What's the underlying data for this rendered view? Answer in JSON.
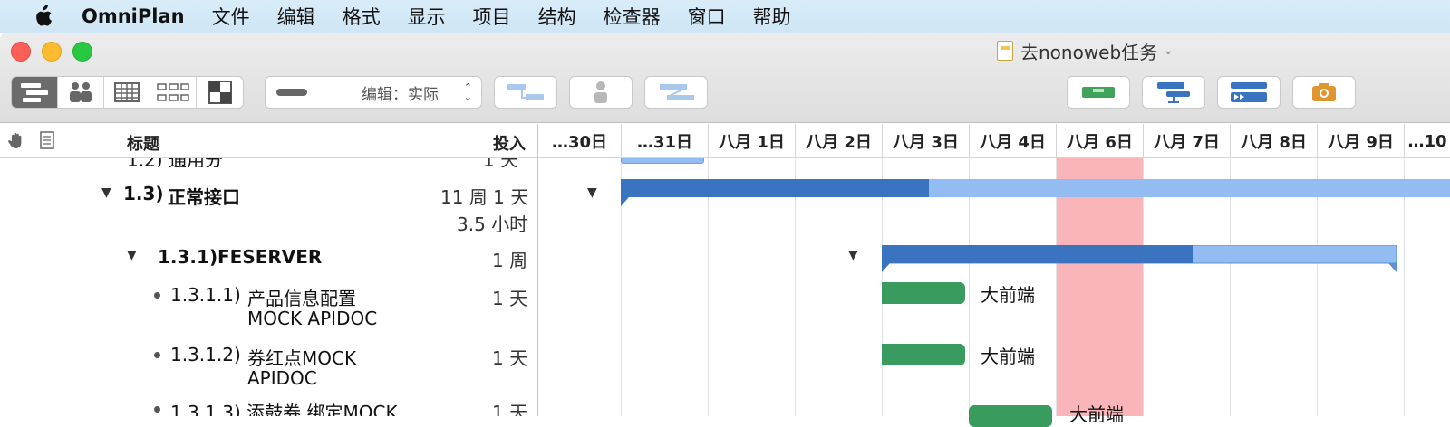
{
  "menubar": {
    "app_name": "OmniPlan",
    "items": [
      "文件",
      "编辑",
      "格式",
      "显示",
      "项目",
      "结构",
      "检查器",
      "窗口",
      "帮助"
    ]
  },
  "window": {
    "title": "去nonoweb任务",
    "popup_label": "编辑：实际"
  },
  "header": {
    "title_col": "标题",
    "effort_col": "投入",
    "dates": [
      "…30日",
      "…31日",
      "八月 1日",
      "八月 2日",
      "八月 3日",
      "八月 4日",
      "八月 6日",
      "八月 7日",
      "八月 8日",
      "八月 9日",
      "…10"
    ]
  },
  "outline": {
    "partial_top": "1.2)  通用分",
    "partial_top_effort": "1 天",
    "row_13_num": "1.3)",
    "row_13_title": "正常接口",
    "row_13_effort_1": "11 周 1 天",
    "row_13_effort_2": "3.5 小时",
    "row_131_num": "1.3.1)",
    "row_131_title": "FESERVER",
    "row_131_effort": "1 周",
    "row_1311_num": "1.3.1.1)",
    "row_1311_title_1": "产品信息配置",
    "row_1311_title_2": "MOCK APIDOC",
    "row_1311_effort": "1 天",
    "row_1312_num": "1.3.1.2)",
    "row_1312_title_1": "券红点MOCK",
    "row_1312_title_2": "APIDOC",
    "row_1312_effort": "1 天",
    "row_1313_partial": "1.3.1.3)  添鼓券 绑定MOCK",
    "row_1313_effort": "1 天"
  },
  "gantt": {
    "resource_1": "大前端",
    "resource_2": "大前端",
    "resource_3": "大前端",
    "colors": {
      "group_done": "#3a73c0",
      "group_remaining": "#93bdf2",
      "task": "#3a9b5e",
      "weekend": "#f9b5b9"
    }
  },
  "icons": [
    "apple-icon",
    "hand-icon",
    "note-icon",
    "disclosure-triangle-icon",
    "camera-icon"
  ]
}
